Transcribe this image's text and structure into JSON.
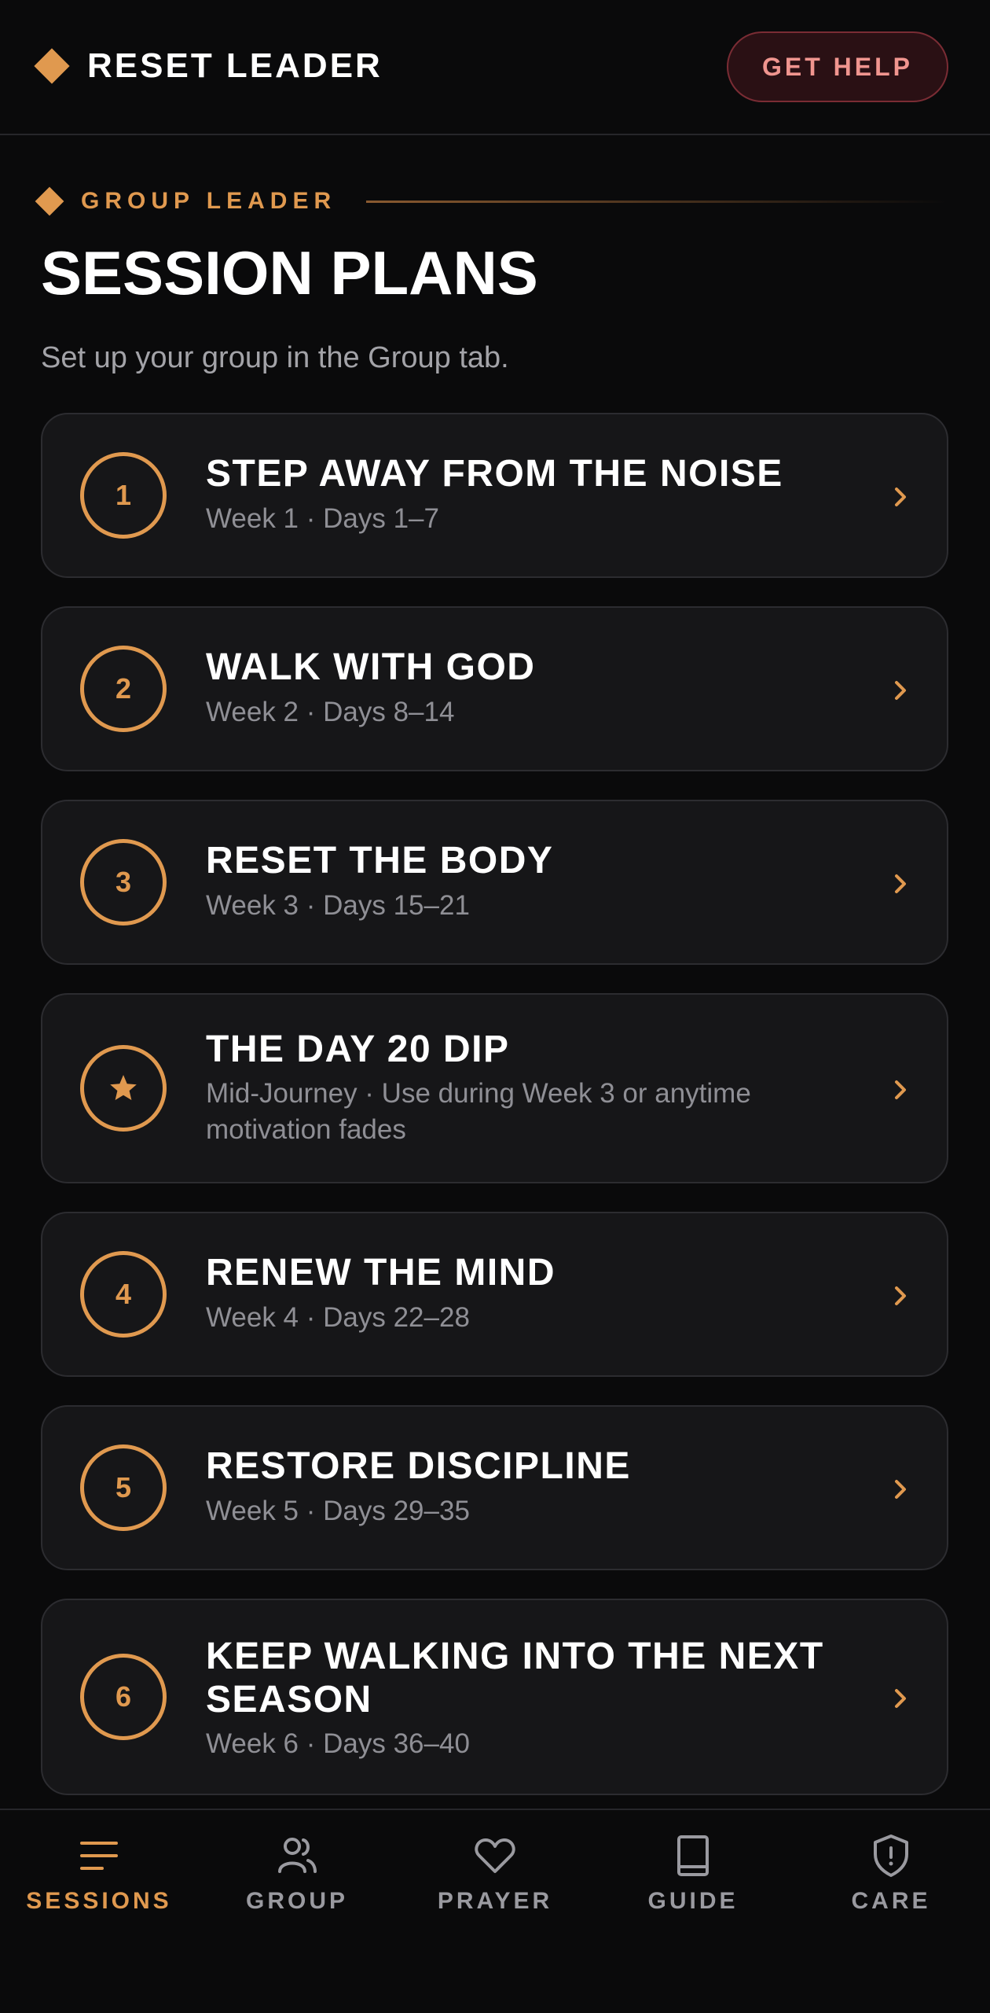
{
  "header": {
    "brand": "RESET LEADER",
    "help_label": "GET HELP"
  },
  "section": {
    "eyebrow": "GROUP LEADER",
    "title": "SESSION PLANS",
    "subtitle": "Set up your group in the Group tab."
  },
  "sessions": [
    {
      "badge": "1",
      "title": "STEP AWAY FROM THE NOISE",
      "subtitle": "Week 1 · Days 1–7"
    },
    {
      "badge": "2",
      "title": "WALK WITH GOD",
      "subtitle": "Week 2 · Days 8–14"
    },
    {
      "badge": "3",
      "title": "RESET THE BODY",
      "subtitle": "Week 3 · Days 15–21"
    },
    {
      "badge_icon": "star-icon",
      "title": "THE DAY 20 DIP",
      "subtitle": "Mid-Journey · Use during Week 3 or anytime motivation fades"
    },
    {
      "badge": "4",
      "title": "RENEW THE MIND",
      "subtitle": "Week 4 · Days 22–28"
    },
    {
      "badge": "5",
      "title": "RESTORE DISCIPLINE",
      "subtitle": "Week 5 · Days 29–35"
    },
    {
      "badge": "6",
      "title": "KEEP WALKING INTO THE NEXT SEASON",
      "subtitle": "Week 6 · Days 36–40"
    }
  ],
  "nav": [
    {
      "label": "SESSIONS",
      "icon": "list-icon",
      "active": true
    },
    {
      "label": "GROUP",
      "icon": "people-icon",
      "active": false
    },
    {
      "label": "PRAYER",
      "icon": "heart-icon",
      "active": false
    },
    {
      "label": "GUIDE",
      "icon": "book-icon",
      "active": false
    },
    {
      "label": "CARE",
      "icon": "shield-icon",
      "active": false
    }
  ],
  "colors": {
    "accent": "#e0994f",
    "background": "#0a0a0b",
    "card": "#161618",
    "help_text": "#f0958f",
    "muted": "#8f8f95"
  }
}
